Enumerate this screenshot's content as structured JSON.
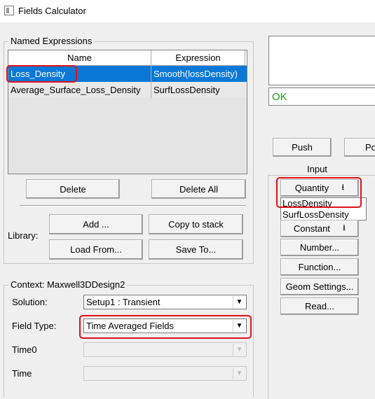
{
  "window": {
    "title": "Fields Calculator"
  },
  "named_expressions": {
    "legend": "Named Expressions",
    "columns": [
      "Name",
      "Expression"
    ],
    "rows": [
      {
        "name": "Loss_Density",
        "expression": "Smooth(lossDensity)",
        "selected": true
      },
      {
        "name": "Average_Surface_Loss_Density",
        "expression": "SurfLossDensity",
        "selected": false
      }
    ],
    "delete_label": "Delete",
    "delete_all_label": "Delete All",
    "library_label": "Library:",
    "add_label": "Add ...",
    "copy_to_stack_label": "Copy to stack",
    "load_from_label": "Load From...",
    "save_to_label": "Save To..."
  },
  "context": {
    "legend": "Context: Maxwell3DDesign2",
    "solution_label": "Solution:",
    "solution_value": "Setup1 : Transient",
    "field_type_label": "Field Type:",
    "field_type_value": "Time Averaged Fields",
    "time0_label": "Time0",
    "time0_value": "",
    "time_label": "Time",
    "time_value": ""
  },
  "right_panel": {
    "status_text": "OK",
    "push_label": "Push",
    "po_label": "Po",
    "input_label": "Input",
    "quantity_label": "Quantity",
    "quantity_options": [
      "LossDensity",
      "SurfLossDensity"
    ],
    "constant_label": "Constant",
    "number_label": "Number...",
    "function_label": "Function...",
    "geom_settings_label": "Geom Settings...",
    "read_label": "Read..."
  },
  "icons": {
    "dropdown": "▼",
    "down_arrow_bar": "⭳"
  },
  "colors": {
    "selection": "#0a78d7",
    "highlight": "#e0121a",
    "status_ok": "#14a01c"
  }
}
